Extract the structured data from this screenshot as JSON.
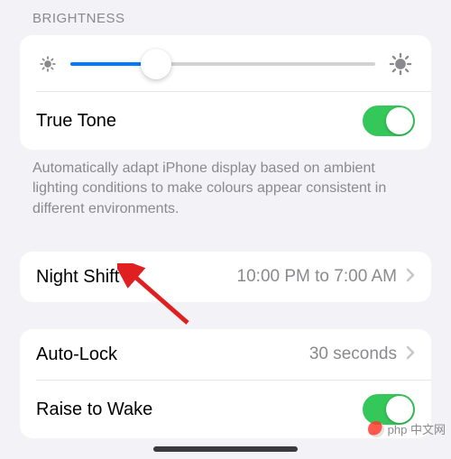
{
  "section": {
    "brightness": "Brightness"
  },
  "slider": {
    "percent": 28,
    "min_icon": "sun-small",
    "max_icon": "sun-large"
  },
  "trueTone": {
    "label": "True Tone",
    "enabled": true,
    "description": "Automatically adapt iPhone display based on ambient lighting conditions to make colours appear consistent in different environments."
  },
  "nightShift": {
    "label": "Night Shift",
    "schedule": "10:00 PM to 7:00 AM"
  },
  "autoLock": {
    "label": "Auto-Lock",
    "value": "30 seconds"
  },
  "raiseToWake": {
    "label": "Raise to Wake",
    "enabled": true
  },
  "watermark": "中文网",
  "colors": {
    "accent": "#007aff",
    "toggle_on": "#34c759"
  }
}
